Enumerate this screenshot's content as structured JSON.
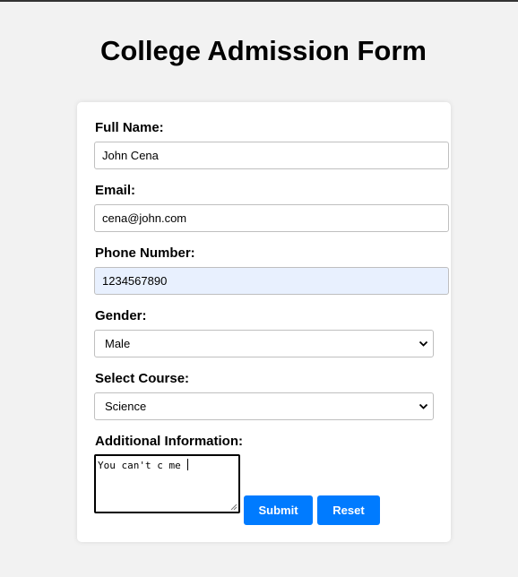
{
  "page": {
    "title": "College Admission Form"
  },
  "form": {
    "full_name": {
      "label": "Full Name:",
      "value": "John Cena"
    },
    "email": {
      "label": "Email:",
      "value": "cena@john.com"
    },
    "phone": {
      "label": "Phone Number:",
      "value": "1234567890"
    },
    "gender": {
      "label": "Gender:",
      "selected": "Male"
    },
    "course": {
      "label": "Select Course:",
      "selected": "Science"
    },
    "additional_info": {
      "label": "Additional Information:",
      "value": "You can't c me "
    },
    "submit_label": "Submit",
    "reset_label": "Reset"
  },
  "colors": {
    "primary_button": "#007bff",
    "autofill_background": "#e8f0fe",
    "page_background": "#f2f2f2"
  },
  "icons": {
    "select_arrow": "chevron-down-icon",
    "textarea_resize": "resize-grip-icon"
  }
}
